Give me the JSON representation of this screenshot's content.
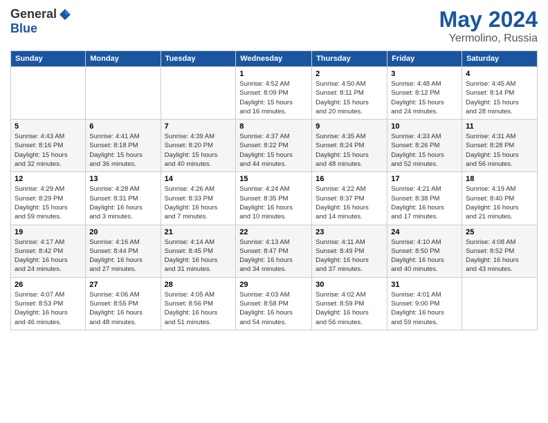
{
  "logo": {
    "general": "General",
    "blue": "Blue"
  },
  "title": "May 2024",
  "location": "Yermolino, Russia",
  "days_of_week": [
    "Sunday",
    "Monday",
    "Tuesday",
    "Wednesday",
    "Thursday",
    "Friday",
    "Saturday"
  ],
  "weeks": [
    [
      {
        "day": "",
        "info": ""
      },
      {
        "day": "",
        "info": ""
      },
      {
        "day": "",
        "info": ""
      },
      {
        "day": "1",
        "info": "Sunrise: 4:52 AM\nSunset: 8:09 PM\nDaylight: 15 hours\nand 16 minutes."
      },
      {
        "day": "2",
        "info": "Sunrise: 4:50 AM\nSunset: 8:11 PM\nDaylight: 15 hours\nand 20 minutes."
      },
      {
        "day": "3",
        "info": "Sunrise: 4:48 AM\nSunset: 8:12 PM\nDaylight: 15 hours\nand 24 minutes."
      },
      {
        "day": "4",
        "info": "Sunrise: 4:45 AM\nSunset: 8:14 PM\nDaylight: 15 hours\nand 28 minutes."
      }
    ],
    [
      {
        "day": "5",
        "info": "Sunrise: 4:43 AM\nSunset: 8:16 PM\nDaylight: 15 hours\nand 32 minutes."
      },
      {
        "day": "6",
        "info": "Sunrise: 4:41 AM\nSunset: 8:18 PM\nDaylight: 15 hours\nand 36 minutes."
      },
      {
        "day": "7",
        "info": "Sunrise: 4:39 AM\nSunset: 8:20 PM\nDaylight: 15 hours\nand 40 minutes."
      },
      {
        "day": "8",
        "info": "Sunrise: 4:37 AM\nSunset: 8:22 PM\nDaylight: 15 hours\nand 44 minutes."
      },
      {
        "day": "9",
        "info": "Sunrise: 4:35 AM\nSunset: 8:24 PM\nDaylight: 15 hours\nand 48 minutes."
      },
      {
        "day": "10",
        "info": "Sunrise: 4:33 AM\nSunset: 8:26 PM\nDaylight: 15 hours\nand 52 minutes."
      },
      {
        "day": "11",
        "info": "Sunrise: 4:31 AM\nSunset: 8:28 PM\nDaylight: 15 hours\nand 56 minutes."
      }
    ],
    [
      {
        "day": "12",
        "info": "Sunrise: 4:29 AM\nSunset: 8:29 PM\nDaylight: 15 hours\nand 59 minutes."
      },
      {
        "day": "13",
        "info": "Sunrise: 4:28 AM\nSunset: 8:31 PM\nDaylight: 16 hours\nand 3 minutes."
      },
      {
        "day": "14",
        "info": "Sunrise: 4:26 AM\nSunset: 8:33 PM\nDaylight: 16 hours\nand 7 minutes."
      },
      {
        "day": "15",
        "info": "Sunrise: 4:24 AM\nSunset: 8:35 PM\nDaylight: 16 hours\nand 10 minutes."
      },
      {
        "day": "16",
        "info": "Sunrise: 4:22 AM\nSunset: 8:37 PM\nDaylight: 16 hours\nand 14 minutes."
      },
      {
        "day": "17",
        "info": "Sunrise: 4:21 AM\nSunset: 8:38 PM\nDaylight: 16 hours\nand 17 minutes."
      },
      {
        "day": "18",
        "info": "Sunrise: 4:19 AM\nSunset: 8:40 PM\nDaylight: 16 hours\nand 21 minutes."
      }
    ],
    [
      {
        "day": "19",
        "info": "Sunrise: 4:17 AM\nSunset: 8:42 PM\nDaylight: 16 hours\nand 24 minutes."
      },
      {
        "day": "20",
        "info": "Sunrise: 4:16 AM\nSunset: 8:44 PM\nDaylight: 16 hours\nand 27 minutes."
      },
      {
        "day": "21",
        "info": "Sunrise: 4:14 AM\nSunset: 8:45 PM\nDaylight: 16 hours\nand 31 minutes."
      },
      {
        "day": "22",
        "info": "Sunrise: 4:13 AM\nSunset: 8:47 PM\nDaylight: 16 hours\nand 34 minutes."
      },
      {
        "day": "23",
        "info": "Sunrise: 4:11 AM\nSunset: 8:49 PM\nDaylight: 16 hours\nand 37 minutes."
      },
      {
        "day": "24",
        "info": "Sunrise: 4:10 AM\nSunset: 8:50 PM\nDaylight: 16 hours\nand 40 minutes."
      },
      {
        "day": "25",
        "info": "Sunrise: 4:08 AM\nSunset: 8:52 PM\nDaylight: 16 hours\nand 43 minutes."
      }
    ],
    [
      {
        "day": "26",
        "info": "Sunrise: 4:07 AM\nSunset: 8:53 PM\nDaylight: 16 hours\nand 46 minutes."
      },
      {
        "day": "27",
        "info": "Sunrise: 4:06 AM\nSunset: 8:55 PM\nDaylight: 16 hours\nand 48 minutes."
      },
      {
        "day": "28",
        "info": "Sunrise: 4:05 AM\nSunset: 8:56 PM\nDaylight: 16 hours\nand 51 minutes."
      },
      {
        "day": "29",
        "info": "Sunrise: 4:03 AM\nSunset: 8:58 PM\nDaylight: 16 hours\nand 54 minutes."
      },
      {
        "day": "30",
        "info": "Sunrise: 4:02 AM\nSunset: 8:59 PM\nDaylight: 16 hours\nand 56 minutes."
      },
      {
        "day": "31",
        "info": "Sunrise: 4:01 AM\nSunset: 9:00 PM\nDaylight: 16 hours\nand 59 minutes."
      },
      {
        "day": "",
        "info": ""
      }
    ]
  ]
}
